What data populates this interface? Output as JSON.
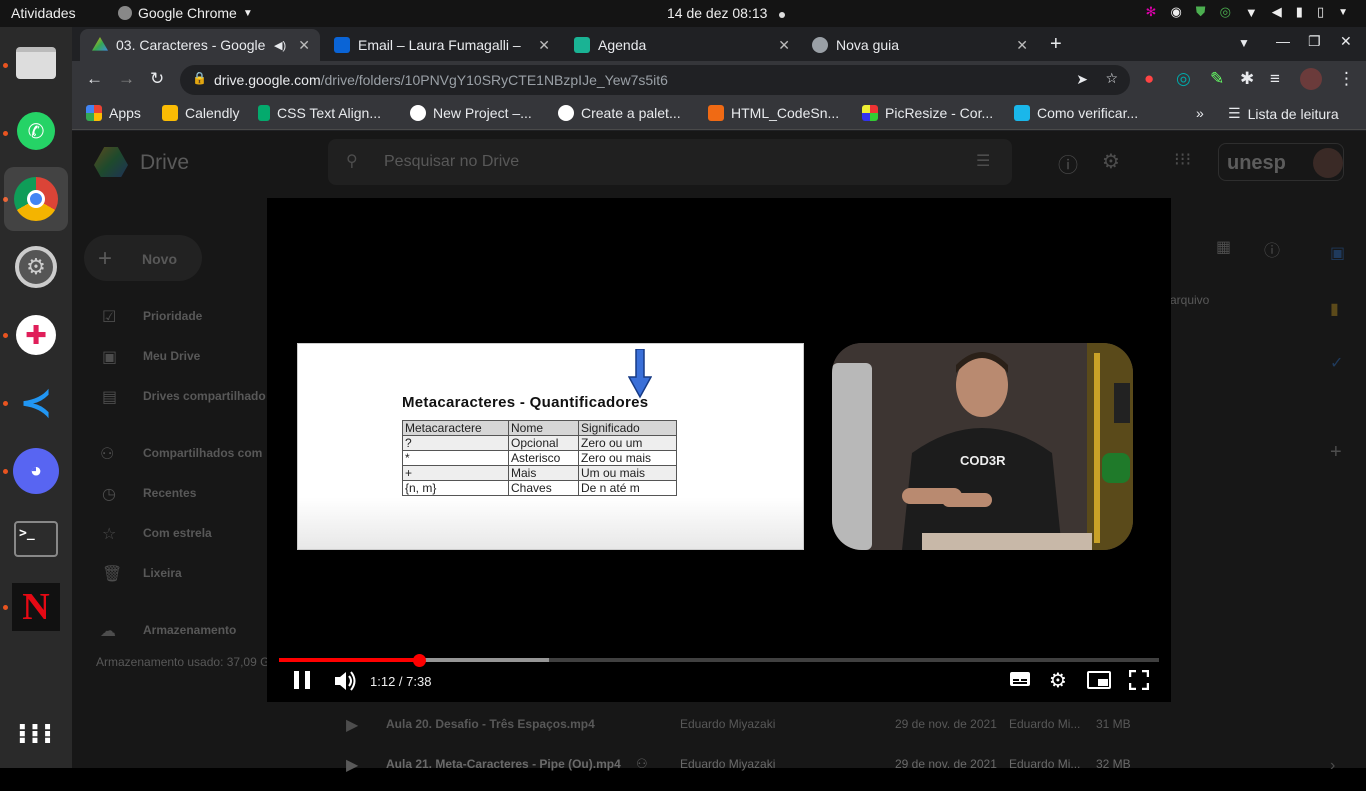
{
  "topbar": {
    "activities": "Atividades",
    "app_name": "Google Chrome",
    "clock": "14 de dez  08:13"
  },
  "dock": {
    "items": [
      "Arquivos",
      "WhatsApp",
      "Google Chrome",
      "Configurações",
      "Slack",
      "Visual Studio Code",
      "Discord",
      "Terminal",
      "Netflix",
      "Mostrar aplicativos"
    ]
  },
  "tabs": [
    {
      "title": "03. Caracteres - Google",
      "active": true
    },
    {
      "title": "Email – Laura Fumagalli –",
      "active": false
    },
    {
      "title": "Agenda",
      "active": false
    },
    {
      "title": "Nova guia",
      "active": false
    }
  ],
  "address": {
    "host": "drive.google.com",
    "path": "/drive/folders/10PNVgY10SRyCTE1NBzpIJe_Yew7s5it6"
  },
  "bookmarks": [
    "Apps",
    "Calendly",
    "CSS Text Align...",
    "New Project –...",
    "Create a palet...",
    "HTML_CodeSn...",
    "PicResize - Cor...",
    "Como verificar..."
  ],
  "reading_list": "Lista de leitura",
  "drive": {
    "logo": "Drive",
    "search_placeholder": "Pesquisar no Drive",
    "org": "unesp",
    "new_button": "Novo",
    "nav": [
      "Prioridade",
      "Meu Drive",
      "Drives compartilhado",
      "Compartilhados com",
      "Recentes",
      "Com estrela",
      "Lixeira",
      "Armazenamento"
    ],
    "storage_used": "Armazenamento usado: 37,09 G",
    "column_hint": "arquivo",
    "files": [
      {
        "name": "Aula 20. Desafio - Três Espaços.mp4",
        "owner": "Eduardo Miyazaki",
        "date": "29 de nov. de 2021",
        "modified_by": "Eduardo Mi...",
        "size": "31 MB"
      },
      {
        "name": "Aula 21. Meta-Caracteres - Pipe (Ou).mp4",
        "owner": "Eduardo Miyazaki",
        "date": "29 de nov. de 2021",
        "modified_by": "Eduardo Mi...",
        "size": "32 MB"
      }
    ]
  },
  "video": {
    "slide_title": "Metacaracteres - Quantificadores",
    "table_headers": [
      "Metacaractere",
      "Nome",
      "Significado"
    ],
    "table_rows": [
      [
        "?",
        "Opcional",
        "Zero ou um"
      ],
      [
        "*",
        "Asterisco",
        "Zero ou mais"
      ],
      [
        "+",
        "Mais",
        "Um ou mais"
      ],
      [
        "{n, m}",
        "Chaves",
        "De n até m"
      ]
    ],
    "shirt_text": "COD3R",
    "time": "1:12 / 7:38",
    "played_fraction": 0.159,
    "buffered_fraction": 0.307
  },
  "colors": {
    "progress": "#ff0000",
    "accent_dock": "#e95420"
  }
}
